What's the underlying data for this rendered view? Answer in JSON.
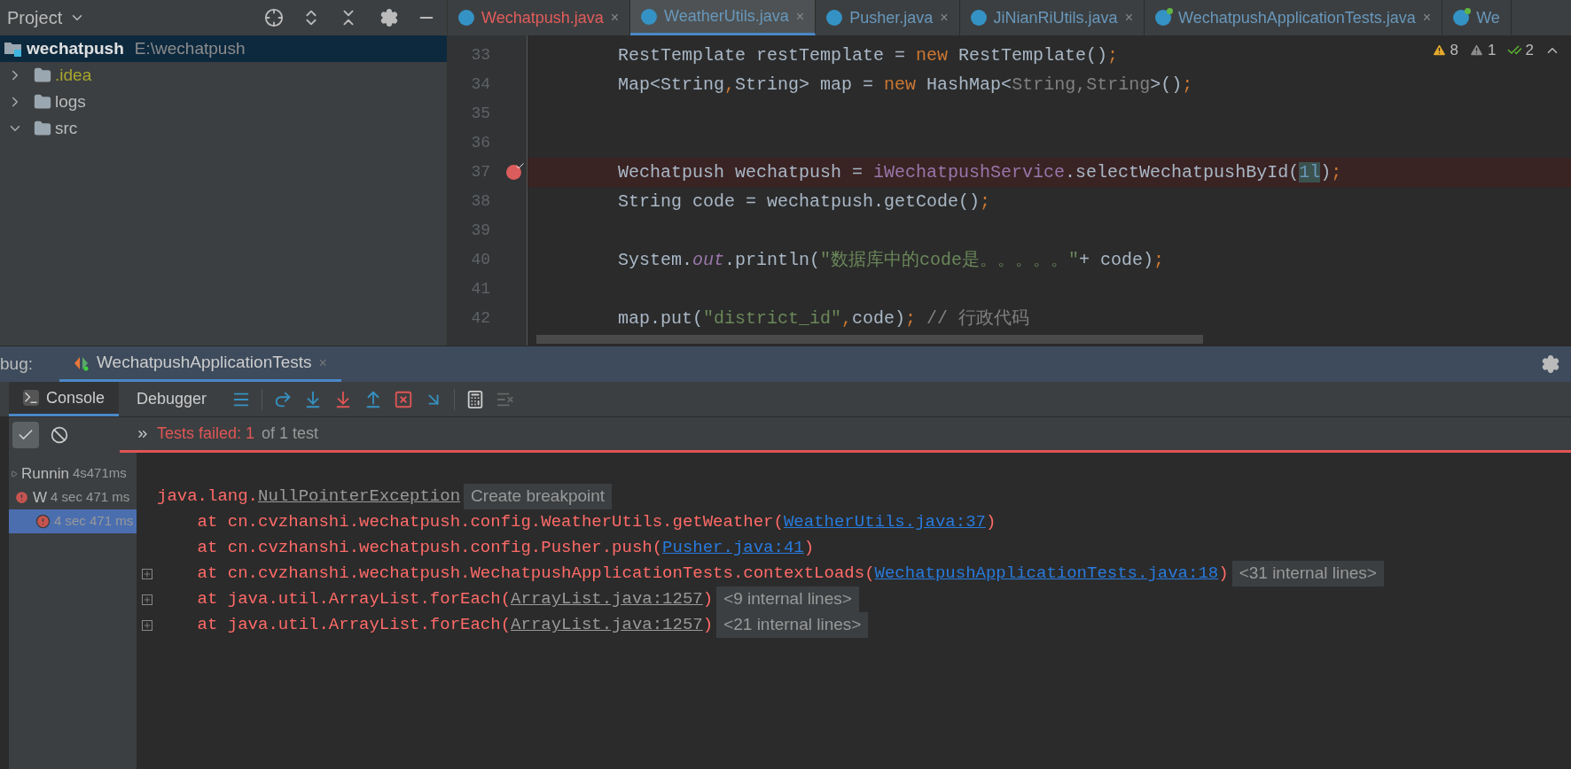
{
  "project_panel": {
    "title": "Project",
    "tree": [
      {
        "label": "wechatpush",
        "path": "E:\\wechatpush",
        "kind": "module",
        "selected": true,
        "children": [
          {
            "label": ".idea",
            "kind": "folder",
            "color": "#a7a72c",
            "selected": false,
            "expanded": false
          },
          {
            "label": "logs",
            "kind": "folder",
            "color": "#bbbbbb",
            "selected": false,
            "expanded": false
          },
          {
            "label": "src",
            "kind": "folder",
            "color": "#bbbbbb",
            "selected": false,
            "expanded": true
          }
        ]
      }
    ]
  },
  "editor": {
    "tabs": [
      {
        "label": "Wechatpush.java",
        "kind": "class",
        "selected": false,
        "error": true,
        "close": "×"
      },
      {
        "label": "WeatherUtils.java",
        "kind": "class",
        "selected": true,
        "error": false,
        "close": "×"
      },
      {
        "label": "Pusher.java",
        "kind": "class",
        "selected": false,
        "error": false,
        "close": "×"
      },
      {
        "label": "JiNianRiUtils.java",
        "kind": "class",
        "selected": false,
        "error": false,
        "close": "×"
      },
      {
        "label": "WechatpushApplicationTests.java",
        "kind": "test",
        "selected": false,
        "error": false,
        "close": "×"
      },
      {
        "label": "We",
        "kind": "test",
        "selected": false,
        "error": false
      }
    ],
    "inspections": [
      {
        "kind": "warning",
        "count": "8"
      },
      {
        "kind": "weak",
        "count": "1"
      },
      {
        "kind": "ok",
        "count": "2"
      }
    ],
    "lines": [
      {
        "number": "33",
        "breakpoint": false,
        "tokens": [
          {
            "text": "RestTemplate restTemplate = ",
            "kind": "plain"
          },
          {
            "text": "new",
            "kind": "keyword"
          },
          {
            "text": " RestTemplate()",
            "kind": "plain"
          },
          {
            "text": ";",
            "kind": "keyword"
          }
        ]
      },
      {
        "number": "34",
        "breakpoint": false,
        "tokens": [
          {
            "text": "Map<String",
            "kind": "plain"
          },
          {
            "text": ",",
            "kind": "keyword"
          },
          {
            "text": "String> map = ",
            "kind": "plain"
          },
          {
            "text": "new",
            "kind": "keyword"
          },
          {
            "text": " HashMap<",
            "kind": "plain"
          },
          {
            "text": "String,String",
            "kind": "dim"
          },
          {
            "text": ">()",
            "kind": "plain"
          },
          {
            "text": ";",
            "kind": "keyword"
          }
        ]
      },
      {
        "number": "35",
        "breakpoint": false
      },
      {
        "number": "36",
        "breakpoint": false
      },
      {
        "number": "37",
        "breakpoint": true,
        "tokens": [
          {
            "text": "Wechatpush wechatpush = ",
            "kind": "plain"
          },
          {
            "text": "iWechatpushService",
            "kind": "field"
          },
          {
            "text": ".selectWechatpushById(",
            "kind": "plain"
          },
          {
            "text": "1l",
            "kind": "number"
          },
          {
            "text": ")",
            "kind": "plain"
          },
          {
            "text": ";",
            "kind": "keyword"
          }
        ]
      },
      {
        "number": "38",
        "breakpoint": false,
        "tokens": [
          {
            "text": "String code = wechatpush.getCode()",
            "kind": "plain"
          },
          {
            "text": ";",
            "kind": "keyword"
          }
        ]
      },
      {
        "number": "39",
        "breakpoint": false
      },
      {
        "number": "40",
        "breakpoint": false,
        "tokens": [
          {
            "text": "System.",
            "kind": "plain"
          },
          {
            "text": "out",
            "kind": "static"
          },
          {
            "text": ".println(",
            "kind": "plain"
          },
          {
            "text": "\"数据库中的code是。。。。。\"",
            "kind": "string"
          },
          {
            "text": "+ code)",
            "kind": "plain"
          },
          {
            "text": ";",
            "kind": "keyword"
          }
        ]
      },
      {
        "number": "41",
        "breakpoint": false
      },
      {
        "number": "42",
        "breakpoint": false,
        "tokens": [
          {
            "text": "map.put(",
            "kind": "plain"
          },
          {
            "text": "\"district_id\"",
            "kind": "string"
          },
          {
            "text": ",",
            "kind": "keyword"
          },
          {
            "text": "code)",
            "kind": "plain"
          },
          {
            "text": ";",
            "kind": "keyword"
          },
          {
            "text": " // 行政代码",
            "kind": "comment"
          }
        ]
      }
    ]
  },
  "debug": {
    "label": "bug:",
    "session": "WechatpushApplicationTests",
    "session_close": "×",
    "tabs": [
      {
        "label": "Console",
        "selected": true
      },
      {
        "label": "Debugger",
        "selected": false
      }
    ],
    "status": "Tests failed: 1",
    "status_rest": "of 1 test",
    "tests": [
      {
        "label": "Runnin",
        "time": "4s471ms",
        "kind": "running",
        "selected": false,
        "children": [
          {
            "label": "W",
            "time": "4 sec 471 ms",
            "kind": "failed",
            "selected": false,
            "children": [
              {
                "time": "4 sec 471 ms",
                "kind": "failed",
                "selected": true
              }
            ]
          }
        ]
      }
    ],
    "console": [
      {
        "expandable": false,
        "segments": [
          {
            "text": "java.lang.",
            "kind": "error"
          },
          {
            "text": "NullPointerException",
            "kind": "gray-link"
          },
          {
            "text": "Create breakpoint",
            "kind": "hint"
          }
        ]
      },
      {
        "expandable": false,
        "segments": [
          {
            "text": "    at cn.cvzhanshi.wechatpush.config.WeatherUtils.getWeather(",
            "kind": "error"
          },
          {
            "text": "WeatherUtils.java:37",
            "kind": "link"
          },
          {
            "text": ")",
            "kind": "error"
          }
        ]
      },
      {
        "expandable": false,
        "segments": [
          {
            "text": "    at cn.cvzhanshi.wechatpush.config.Pusher.push(",
            "kind": "error"
          },
          {
            "text": "Pusher.java:41",
            "kind": "link"
          },
          {
            "text": ")",
            "kind": "error"
          }
        ]
      },
      {
        "expandable": true,
        "segments": [
          {
            "text": "    at cn.cvzhanshi.wechatpush.WechatpushApplicationTests.contextLoads(",
            "kind": "error"
          },
          {
            "text": "WechatpushApplicationTests.java:18",
            "kind": "link"
          },
          {
            "text": ")",
            "kind": "error"
          },
          {
            "text": "<31 internal lines>",
            "kind": "hint"
          }
        ]
      },
      {
        "expandable": true,
        "segments": [
          {
            "text": "    at java.util.ArrayList.forEach(",
            "kind": "error"
          },
          {
            "text": "ArrayList.java:1257",
            "kind": "gray-link"
          },
          {
            "text": ")",
            "kind": "error"
          },
          {
            "text": "<9 internal lines>",
            "kind": "hint"
          }
        ]
      },
      {
        "expandable": true,
        "segments": [
          {
            "text": "    at java.util.ArrayList.forEach(",
            "kind": "error"
          },
          {
            "text": "ArrayList.java:1257",
            "kind": "gray-link"
          },
          {
            "text": ")",
            "kind": "error"
          },
          {
            "text": "<21 internal lines>",
            "kind": "hint"
          }
        ]
      }
    ]
  }
}
